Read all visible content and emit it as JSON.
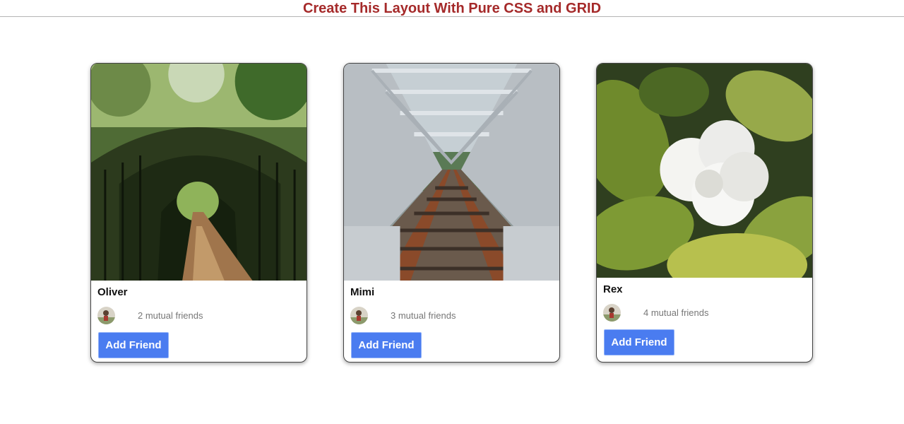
{
  "header": {
    "title": "Create This Layout With Pure CSS and GRID"
  },
  "colors": {
    "title": "#a52a2a",
    "button": "#4a7cf0",
    "button_text": "#ffffff",
    "mutual_text": "#777777"
  },
  "cards": [
    {
      "name": "Oliver",
      "mutual_friends": "2 mutual friends",
      "button_label": "Add Friend",
      "photo": "leafy tunnel pathway"
    },
    {
      "name": "Mimi",
      "mutual_friends": "3 mutual friends",
      "button_label": "Add Friend",
      "photo": "railway bridge tracks"
    },
    {
      "name": "Rex",
      "mutual_friends": "4 mutual friends",
      "button_label": "Add Friend",
      "photo": "white flower with green leaves"
    }
  ]
}
